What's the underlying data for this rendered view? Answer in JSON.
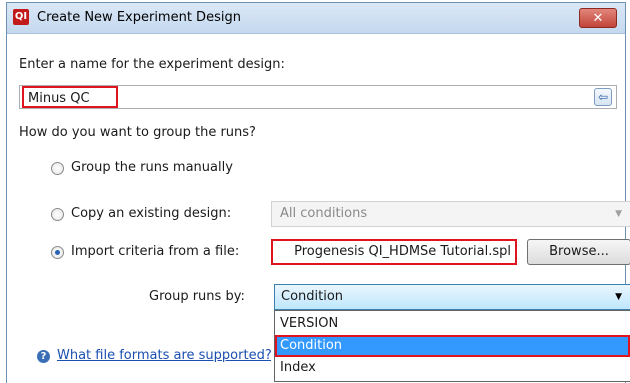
{
  "window": {
    "title": "Create New Experiment Design",
    "close_glyph": "✕",
    "app_icon_text": "QI"
  },
  "name_section": {
    "prompt": "Enter a name for the experiment design:",
    "value": "Minus QC",
    "arrow_glyph": "⇦"
  },
  "group_section": {
    "prompt": "How do you want to group the runs?",
    "options": [
      {
        "label": "Group the runs manually",
        "selected": false
      },
      {
        "label": "Copy an existing design:",
        "selected": false
      },
      {
        "label": "Import criteria from a file:",
        "selected": true
      }
    ],
    "copy_design_value": "All conditions",
    "import_file_value": "Progenesis QI_HDMSe Tutorial.spl",
    "browse_label": "Browse...",
    "group_by_label": "Group runs by:",
    "group_by_value": "Condition",
    "dropdown_options": [
      "VERSION",
      "Condition",
      "Index"
    ],
    "dropdown_selected_index": 1
  },
  "help": {
    "link_text": "What file formats are supported?",
    "icon_glyph": "?"
  },
  "colors": {
    "highlight": "#e0141e",
    "selection": "#3399ff"
  }
}
